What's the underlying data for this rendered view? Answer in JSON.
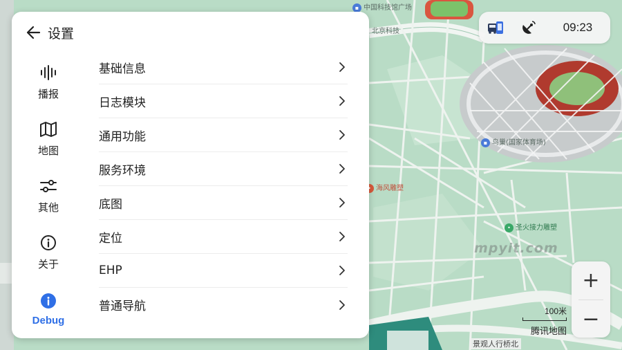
{
  "map": {
    "poi_labels": {
      "plaza": "中国科技馆广场",
      "north_gate": "北京科技",
      "stadium": "鸟巢(国家体育场)",
      "statue": "海风雕塑",
      "torch": "圣火接力雕塑"
    },
    "watermark": "mpyit.com",
    "road_label": "景观人行桥北",
    "colors": {
      "land": "#b9dcc6",
      "road": "#eef3ef",
      "road_edge": "#9fc8b2",
      "stadium_red": "#b03a2e"
    }
  },
  "status_bar": {
    "vehicle_icon": "vehicle-status-icon",
    "satellite_icon": "satellite-dish-icon",
    "time": "09:23"
  },
  "zoom": {
    "in_label": "+",
    "out_label": "−"
  },
  "scale": {
    "distance": "100米",
    "brand": "腾讯地图"
  },
  "settings": {
    "title": "设置",
    "back_icon": "arrow-left-icon",
    "accent": "#2f6fe6",
    "sidebar": [
      {
        "label": "播报",
        "icon": "broadcast-icon",
        "active": false
      },
      {
        "label": "地图",
        "icon": "map-icon",
        "active": false
      },
      {
        "label": "其他",
        "icon": "sliders-icon",
        "active": false
      },
      {
        "label": "关于",
        "icon": "info-icon",
        "active": false
      },
      {
        "label": "Debug",
        "icon": "info-filled-icon",
        "active": true
      }
    ],
    "menu": [
      {
        "label": "基础信息"
      },
      {
        "label": "日志模块"
      },
      {
        "label": "通用功能"
      },
      {
        "label": "服务环境"
      },
      {
        "label": "底图"
      },
      {
        "label": "定位"
      },
      {
        "label": "EHP"
      },
      {
        "label": "普通导航"
      }
    ]
  }
}
